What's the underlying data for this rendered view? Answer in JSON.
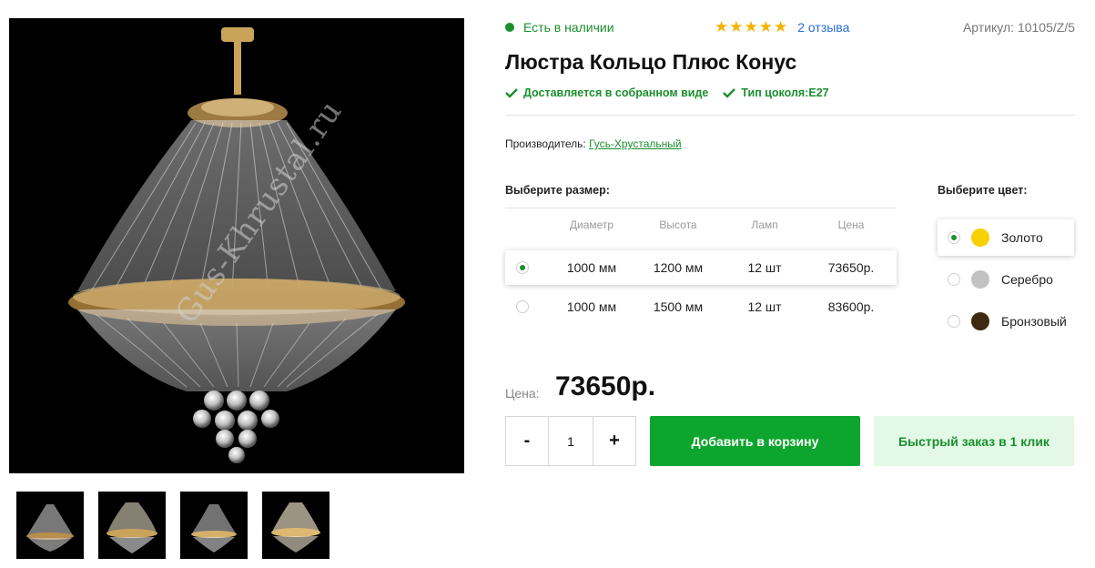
{
  "product": {
    "stock_status": "Есть в наличии",
    "rating": {
      "stars": 5,
      "reviews_text": "2 отзыва"
    },
    "sku": "Артикул: 10105/Z/5",
    "title": "Люстра Кольцо Плюс Конус",
    "features": [
      {
        "label": "Доставляется в собранном виде"
      },
      {
        "label": "Тип цоколя:E27"
      }
    ],
    "manufacturer_label": "Производитель:",
    "manufacturer": "Гусь-Хрустальный",
    "watermark": "Gus-Khrustal.ru"
  },
  "sizes": {
    "label": "Выберите размер:",
    "headers": [
      "Диаметр",
      "Высота",
      "Ламп",
      "Цена"
    ],
    "rows": [
      {
        "diameter": "1000 мм",
        "height": "1200 мм",
        "lamps": "12 шт",
        "price": "73650р.",
        "selected": true
      },
      {
        "diameter": "1000 мм",
        "height": "1500 мм",
        "lamps": "12 шт",
        "price": "83600р.",
        "selected": false
      }
    ]
  },
  "colors": {
    "label": "Выберите цвет:",
    "options": [
      {
        "name": "Золото",
        "swatch": "#f7d000",
        "selected": true
      },
      {
        "name": "Серебро",
        "swatch": "#c2c2c2",
        "selected": false
      },
      {
        "name": "Бронзовый",
        "swatch": "#3d2a10",
        "selected": false
      }
    ]
  },
  "purchase": {
    "price_label": "Цена:",
    "price": "73650р.",
    "qty_minus": "-",
    "qty_value": "1",
    "qty_plus": "+",
    "add_to_cart": "Добавить в корзину",
    "quick_order": "Быстрый заказ в 1 клик"
  },
  "theme": {
    "accent": "#0ea52f",
    "text_green": "#1a8f2e",
    "link_blue": "#2a6fd6",
    "star": "#f5b301"
  }
}
